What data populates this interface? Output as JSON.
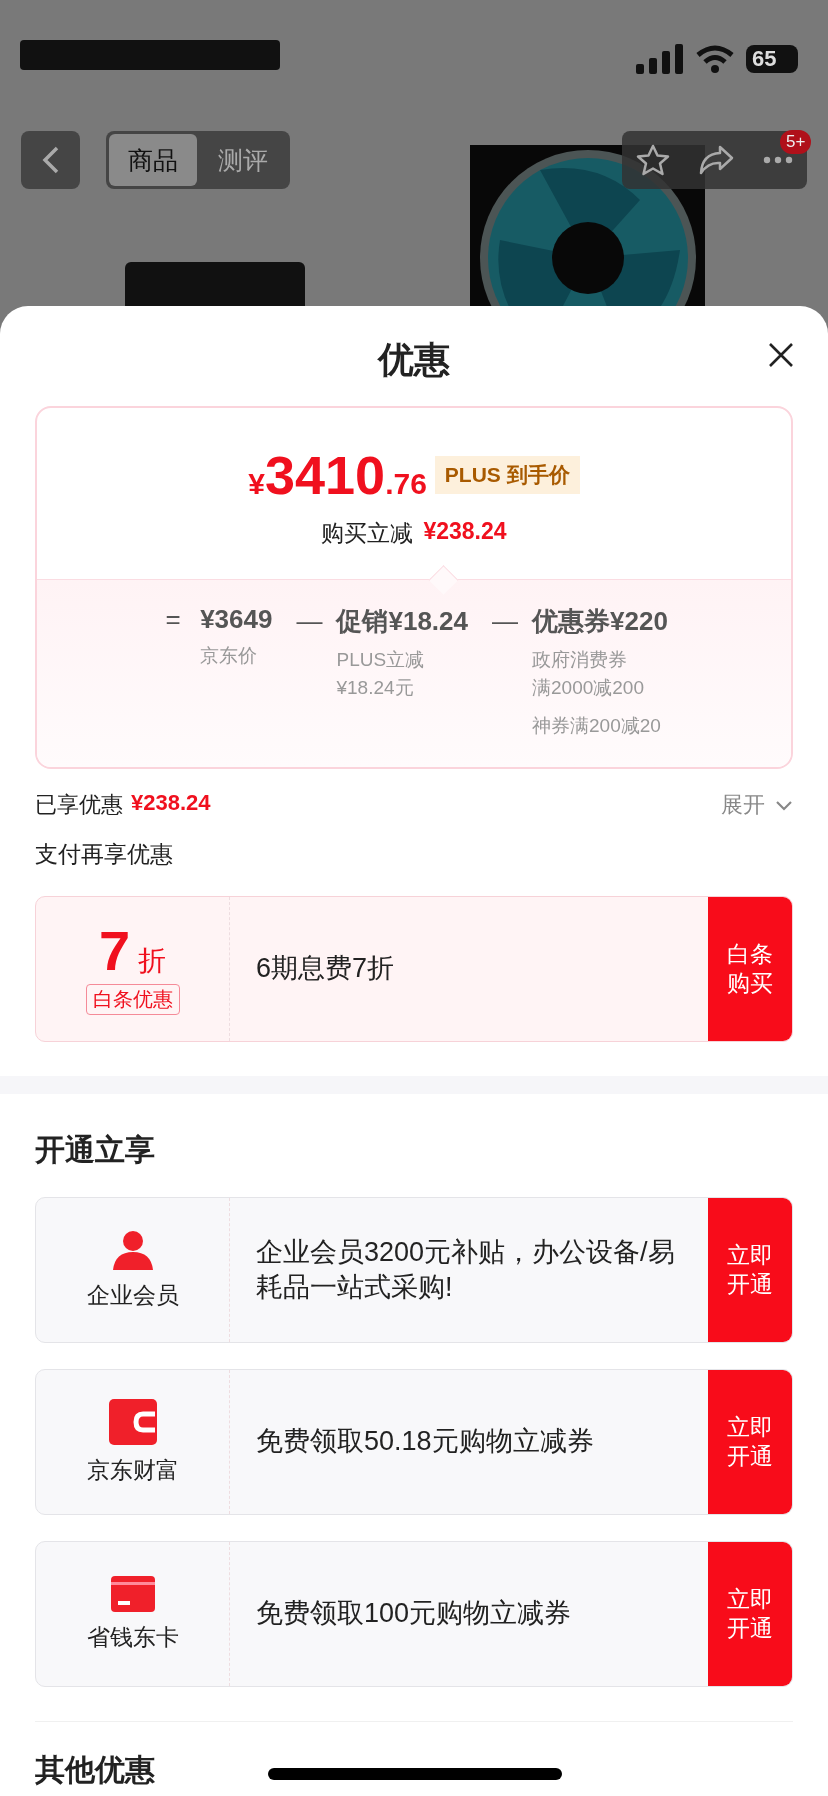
{
  "status_bar": {
    "battery": "65"
  },
  "header": {
    "tabs": [
      {
        "label": "商品",
        "selected": true
      },
      {
        "label": "测评",
        "selected": false
      }
    ],
    "badge": "5+"
  },
  "sheet": {
    "title": "优惠",
    "price": {
      "currency": "¥",
      "integer": "3410",
      "decimal": ".76",
      "tag": "PLUS 到手价",
      "reduction_label": "购买立减",
      "reduction": "¥238.24"
    },
    "breakdown": [
      {
        "operator": "=",
        "value": "¥3649",
        "groups": [
          [
            "京东价"
          ]
        ]
      },
      {
        "operator": "—",
        "value": "促销¥18.24",
        "groups": [
          [
            "PLUS立减",
            "¥18.24元"
          ]
        ]
      },
      {
        "operator": "—",
        "value": "优惠券¥220",
        "groups": [
          [
            "政府消费券",
            "满2000减200"
          ],
          [
            "神券满200减20"
          ]
        ]
      }
    ],
    "saved": {
      "label": "已享优惠",
      "amount": "¥238.24",
      "toggle": "展开",
      "expanded": false
    },
    "pay_title": "支付再享优惠",
    "pay_offers": [
      {
        "big": "7",
        "unit": "折",
        "tag": "白条优惠",
        "text": "6期息费7折",
        "action": "白条购买"
      }
    ],
    "open_title": "开通立享",
    "memberships": [
      {
        "kind": "person",
        "name": "企业会员",
        "text": "企业会员3200元补贴，办公设备/易耗品一站式采购!",
        "action": "立即开通"
      },
      {
        "kind": "wallet",
        "name": "京东财富",
        "text": "免费领取50.18元购物立减券",
        "action": "立即开通"
      },
      {
        "kind": "card",
        "name": "省钱东卡",
        "text": "免费领取100元购物立减券",
        "action": "立即开通"
      }
    ],
    "other_title": "其他优惠"
  }
}
